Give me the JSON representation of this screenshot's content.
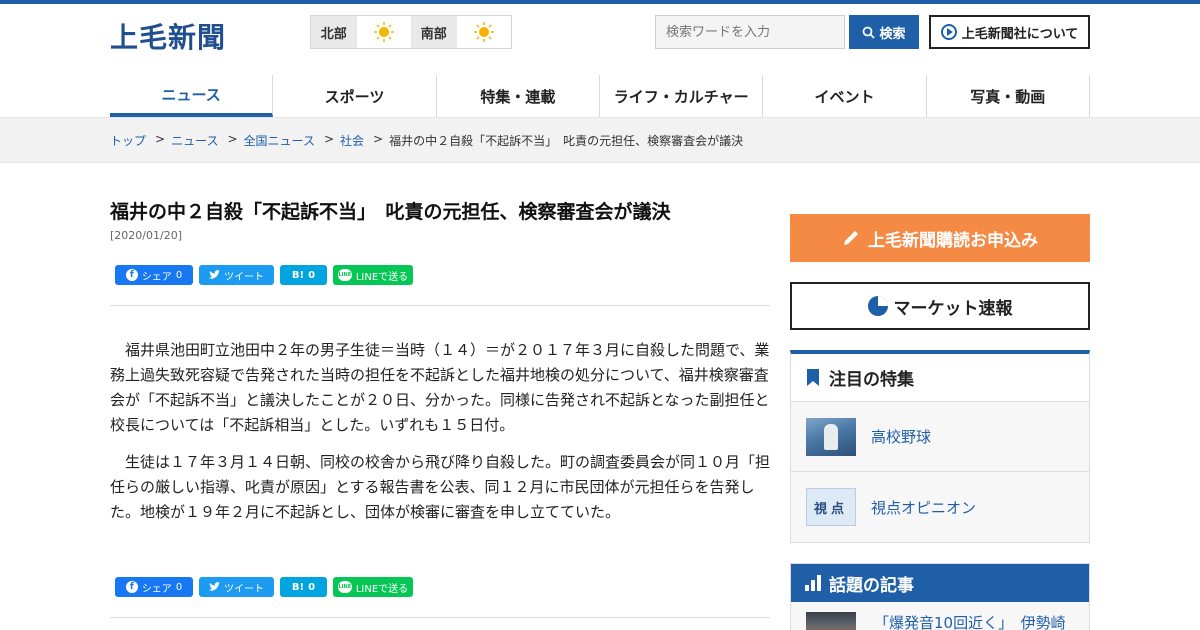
{
  "header": {
    "logo": "上毛新聞",
    "weather": [
      {
        "region": "北部",
        "icon": "sun-icon"
      },
      {
        "region": "南部",
        "icon": "sun-icon"
      }
    ],
    "search_placeholder": "検索ワードを入力",
    "search_label": "検索",
    "about_label": "上毛新聞社について"
  },
  "nav": {
    "items": [
      "ニュース",
      "スポーツ",
      "特集・連載",
      "ライフ・カルチャー",
      "イベント",
      "写真・動画"
    ]
  },
  "breadcrumb": [
    "トップ",
    "ニュース",
    "全国ニュース",
    "社会",
    "福井の中２自殺「不起訴不当」　叱責の元担任、検察審査会が議決"
  ],
  "article": {
    "title": "福井の中２自殺「不起訴不当」　叱責の元担任、検察審査会が議決",
    "date": "[2020/01/20]",
    "share": {
      "facebook": "シェア",
      "facebook_count": "0",
      "twitter": "ツイート",
      "hatena": "B!",
      "hatena_count": "0",
      "line": "LINEで送る",
      "line_icon_text": "LINE"
    },
    "paragraphs": [
      "福井県池田町立池田中２年の男子生徒＝当時（１４）＝が２０１７年３月に自殺した問題で、業務上過失致死容疑で告発された当時の担任を不起訴とした福井地検の処分について、福井検察審査会が「不起訴不当」と議決したことが２０日、分かった。同様に告発され不起訴となった副担任と校長については「不起訴相当」とした。いずれも１５日付。",
      "生徒は１７年３月１４日朝、同校の校舎から飛び降り自殺した。町の調査委員会が同１０月「担任らの厳しい指導、叱責が原因」とする報告書を公表、同１２月に市民団体が元担任らを告発した。地検が１９年２月に不起訴とし、団体が検審に審査を申し立てていた。"
    ]
  },
  "sidebar": {
    "subscribe_label": "上毛新聞購読お申込み",
    "market_label": "マーケット速報",
    "feature_title": "注目の特集",
    "features": [
      {
        "label": "高校野球"
      },
      {
        "label": "視点オピニオン",
        "thumb_text": "視点"
      }
    ],
    "topics_title": "話題の記事",
    "topics": [
      {
        "label": "「爆発音10回近く」　伊勢崎"
      }
    ]
  },
  "colors": {
    "brand": "#1f5fa8",
    "subscribe": "#f58a45",
    "facebook": "#1877f2",
    "twitter": "#1d9bf0",
    "hatena": "#00a4de",
    "line": "#06c755"
  }
}
